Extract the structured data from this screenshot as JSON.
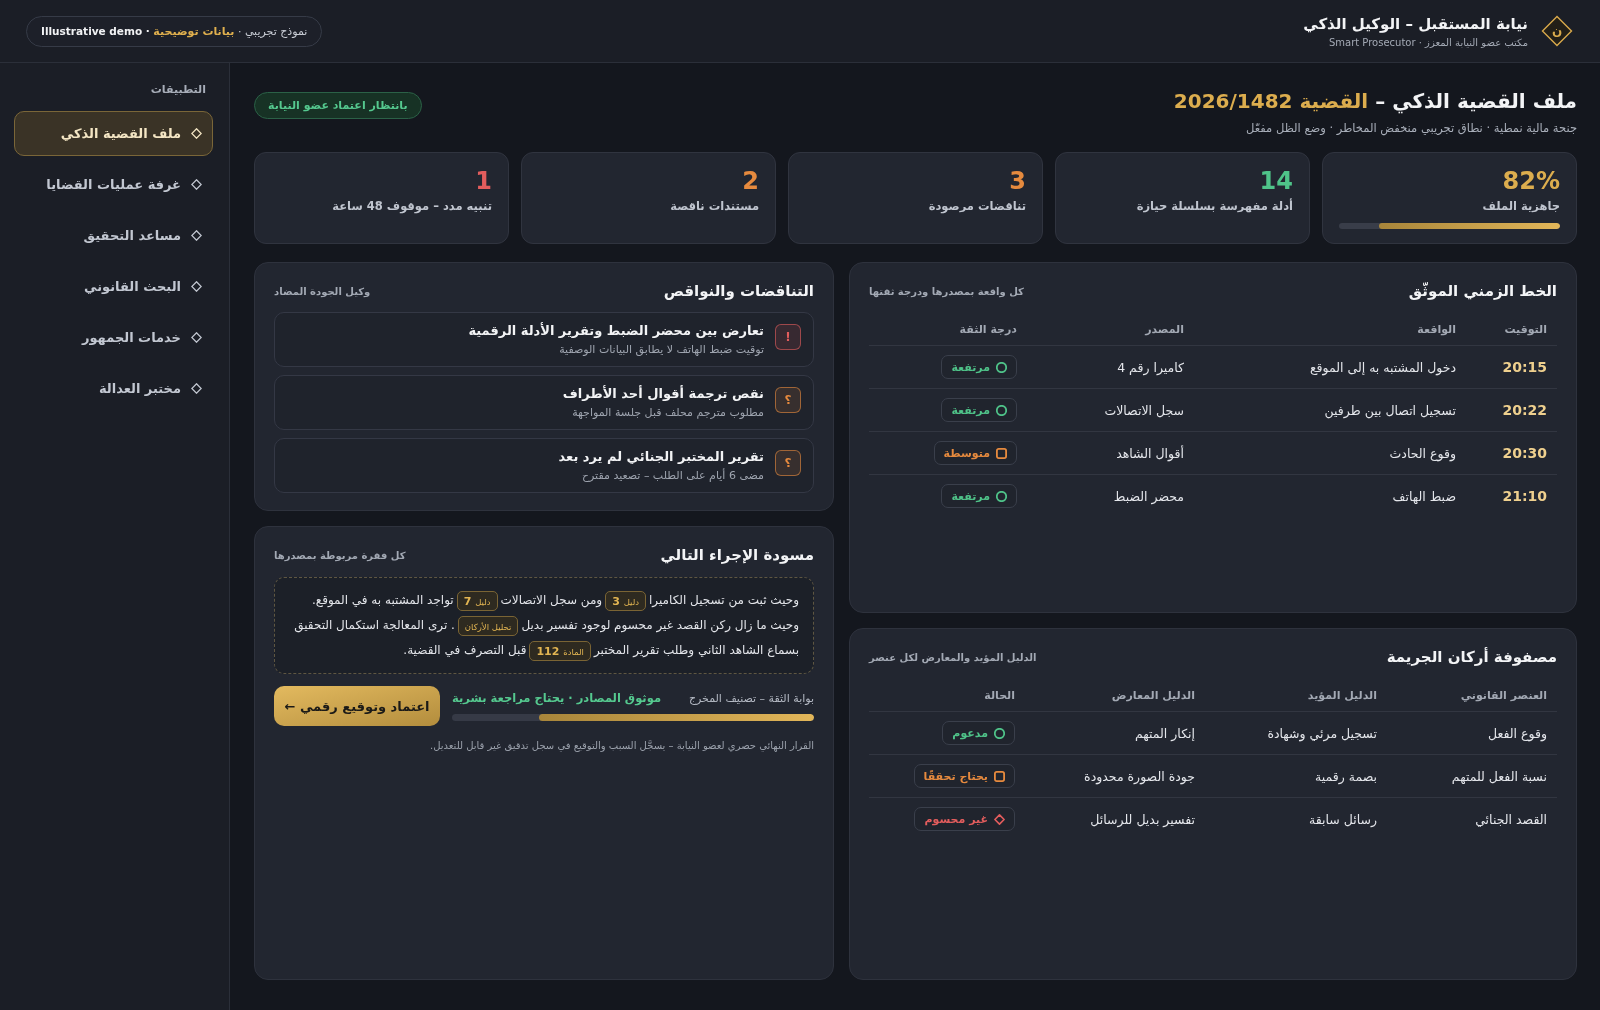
{
  "header": {
    "logo": "ن",
    "title": "نيابة المستقبل – الوكيل الذكي",
    "subtitle": "مكتب عضو النيابة المعزز · Smart Prosecutor",
    "demo_pill": [
      {
        "text": "نموذج تجريبي ·",
        "kind": "plain"
      },
      {
        "text": "بيانات توضيحية",
        "kind": "accent"
      },
      {
        "text": "· Illustrative demo",
        "kind": "strong"
      }
    ]
  },
  "sidebar": {
    "heading": "التطبيقات",
    "items": [
      {
        "label": "ملف القضية الذكي",
        "selected": true
      },
      {
        "label": "غرفة عمليات القضايا",
        "selected": false
      },
      {
        "label": "مساعد التحقيق",
        "selected": false
      },
      {
        "label": "البحث القانوني",
        "selected": false
      },
      {
        "label": "خدمات الجمهور",
        "selected": false
      },
      {
        "label": "مختبر العدالة",
        "selected": false
      }
    ]
  },
  "page": {
    "title": "ملف القضية الذكي –",
    "case": "القضية 2026/1482",
    "subtitle": "جنحة مالية نمطية · نطاق تجريبي منخفض المخاطر · وضع الظل مفعّل",
    "status_badge": "بانتظار اعتماد عضو النيابة"
  },
  "kpis": [
    {
      "kind": "meter",
      "value": "82%",
      "label": "جاهزية الملف",
      "color": "#dcad4e",
      "level": 0.82
    },
    {
      "kind": "count",
      "value": "14",
      "label": "أدلة مفهرسة بسلسلة حيازة",
      "color": "#4fc389"
    },
    {
      "kind": "count",
      "value": "3",
      "label": "تناقضات مرصودة",
      "color": "#e68a3e"
    },
    {
      "kind": "count",
      "value": "2",
      "label": "مستندات ناقصة",
      "color": "#e68a3e"
    },
    {
      "kind": "count",
      "value": "1",
      "label": "تنبيه مدد – موقوف 48 ساعة",
      "color": "#e35d5d"
    }
  ],
  "timeline": {
    "title": "الخط الزمني الموثّق",
    "subtitle": "كل واقعة بمصدرها ودرجة ثقتها",
    "columns": [
      "التوقيت",
      "الواقعة",
      "المصدر",
      "درجة الثقة"
    ],
    "rows": [
      {
        "time": "20:15",
        "event": "دخول المشتبه به إلى الموقع",
        "source": "كاميرا رقم 4",
        "confidence": {
          "label": "مرتفعة",
          "kind": "circle",
          "color": "#4fc389"
        }
      },
      {
        "time": "20:22",
        "event": "تسجيل اتصال بين طرفين",
        "source": "سجل الاتصالات",
        "confidence": {
          "label": "مرتفعة",
          "kind": "circle",
          "color": "#4fc389"
        }
      },
      {
        "time": "20:30",
        "event": "وقوع الحادث",
        "source": "أقوال الشاهد",
        "confidence": {
          "label": "متوسطة",
          "kind": "square",
          "color": "#e68a3e"
        }
      },
      {
        "time": "21:10",
        "event": "ضبط الهاتف",
        "source": "محضر الضبط",
        "confidence": {
          "label": "مرتفعة",
          "kind": "circle",
          "color": "#4fc389"
        }
      }
    ]
  },
  "issues": {
    "title": "التناقضات والنواقص",
    "subtitle": "وكيل الجودة المضاد",
    "items": [
      {
        "icon": {
          "glyph": "!",
          "color": "#e35d5d"
        },
        "title": "تعارض بين محضر الضبط وتقرير الأدلة الرقمية",
        "detail": "توقيت ضبط الهاتف لا يطابق البيانات الوصفية"
      },
      {
        "icon": {
          "glyph": "؟",
          "color": "#e68a3e"
        },
        "title": "نقص ترجمة أقوال أحد الأطراف",
        "detail": "مطلوب مترجم محلف قبل جلسة المواجهة"
      },
      {
        "icon": {
          "glyph": "؟",
          "color": "#e68a3e"
        },
        "title": "تقرير المختبر الجنائي لم يرد بعد",
        "detail": "مضى 6 أيام على الطلب – تصعيد مقترح"
      }
    ]
  },
  "draft": {
    "title": "مسودة الإجراء التالي",
    "subtitle": "كل فقرة مربوطة بمصدرها",
    "paragraph": [
      {
        "kind": "text",
        "text": "وحيث ثبت من تسجيل الكاميرا"
      },
      {
        "kind": "cite",
        "label": "دليل",
        "ref": "3"
      },
      {
        "kind": "text",
        "text": "ومن سجل الاتصالات"
      },
      {
        "kind": "cite",
        "label": "دليل",
        "ref": "7"
      },
      {
        "kind": "text",
        "text": "تواجد المشتبه به في الموقع. وحيث ما زال ركن القصد غير محسوم لوجود تفسير بديل"
      },
      {
        "kind": "cite",
        "label": "تحليل الأركان"
      },
      {
        "kind": "text",
        "text": ". ترى المعالجة استكمال التحقيق بسماع الشاهد الثاني وطلب تقرير المختبر"
      },
      {
        "kind": "cite",
        "label": "المادة",
        "ref": "112"
      },
      {
        "kind": "text",
        "text": "قبل التصرف في القضية."
      }
    ],
    "gate": {
      "label": "بوابة الثقة – تصنيف المخرج",
      "verdict": "موثوق المصادر · يحتاج مراجعة بشرية",
      "level": 0.76
    },
    "button": "اعتماد وتوقيع رقمي ←",
    "footnote": "القرار النهائي حصري لعضو النيابة – يسجَّل السبب والتوقيع في سجل تدقيق غير قابل للتعديل."
  },
  "elements_matrix": {
    "title": "مصفوفة أركان الجريمة",
    "subtitle": "الدليل المؤيد والمعارض لكل عنصر",
    "columns": [
      "العنصر القانوني",
      "الدليل المؤيد",
      "الدليل المعارض",
      "الحالة"
    ],
    "rows": [
      {
        "element": "وقوع الفعل",
        "supporting": "تسجيل مرئي وشهادة",
        "opposing": "إنكار المتهم",
        "status": {
          "label": "مدعوم",
          "kind": "circle",
          "color": "#4fc389"
        }
      },
      {
        "element": "نسبة الفعل للمتهم",
        "supporting": "بصمة رقمية",
        "opposing": "جودة الصورة محدودة",
        "status": {
          "label": "يحتاج تحققًا",
          "kind": "square",
          "color": "#e68a3e"
        }
      },
      {
        "element": "القصد الجنائي",
        "supporting": "رسائل سابقة",
        "opposing": "تفسير بديل للرسائل",
        "status": {
          "label": "غير محسوم",
          "kind": "diamond",
          "color": "#e35d5d"
        }
      }
    ]
  }
}
